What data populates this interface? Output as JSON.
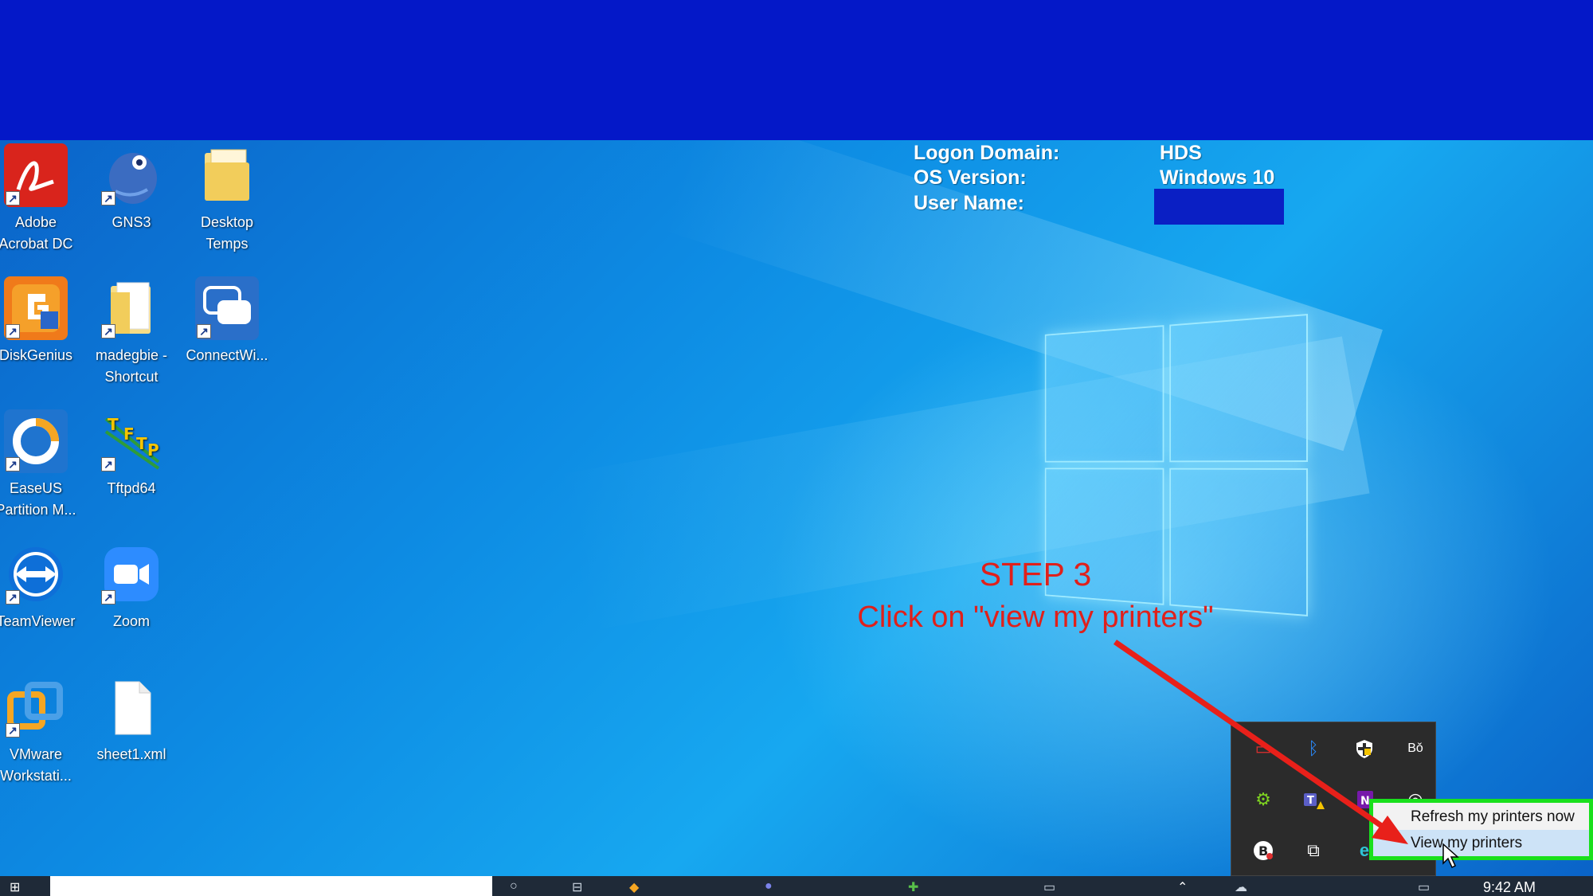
{
  "logon_info": {
    "domain_label": "Logon Domain:",
    "domain_value": "HDS",
    "os_label": "OS Version:",
    "os_value": "Windows 10",
    "user_label": "User Name:"
  },
  "desktop_icons": [
    {
      "label": "Adobe Acrobat DC",
      "icon": "pdf-icon",
      "color": "#d9241c"
    },
    {
      "label": "GNS3",
      "icon": "gns3-icon",
      "color": "#3b6cc1"
    },
    {
      "label": "Desktop Temps",
      "icon": "folder-icon",
      "color": "#f2d675"
    },
    {
      "label": "DiskGenius",
      "icon": "diskgenius-icon",
      "color": "#f07a1a"
    },
    {
      "label": "madegbie - Shortcut",
      "icon": "folder-icon",
      "color": "#f2d675"
    },
    {
      "label": "ConnectWi...",
      "icon": "chat-icon",
      "color": "#2a6fc9"
    },
    {
      "label": "EaseUS Partition M...",
      "icon": "easeus-icon",
      "color": "#1f74cf"
    },
    {
      "label": "Tftpd64",
      "icon": "tftp-icon",
      "color": "#2e9c3a"
    },
    {
      "label": "TeamViewer",
      "icon": "teamviewer-icon",
      "color": "#0e6fd8"
    },
    {
      "label": "Zoom",
      "icon": "zoom-icon",
      "color": "#2d8cff"
    },
    {
      "label": "VMware Workstati...",
      "icon": "vmware-icon",
      "color": "#f5a623"
    },
    {
      "label": "sheet1.xml",
      "icon": "file-icon",
      "color": "#ffffff"
    }
  ],
  "annotation": {
    "step": "STEP 3",
    "instruction": "Click on \"view my printers\"",
    "color": "#e0201b"
  },
  "context_menu": {
    "refresh": "Refresh my printers now",
    "view": "View my printers",
    "highlight_color": "#19e01c"
  },
  "taskbar": {
    "clock": "9:42 AM"
  }
}
